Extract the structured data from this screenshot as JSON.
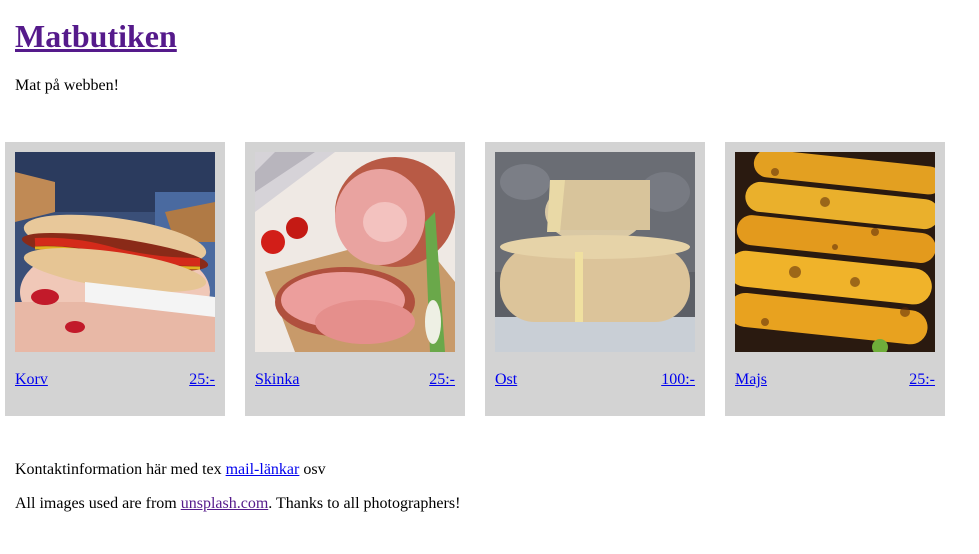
{
  "header": {
    "title": "Matbutiken",
    "tagline": "Mat på webben!"
  },
  "products": [
    {
      "name": "Korv",
      "price": "25:-",
      "image": "hotdog-photo"
    },
    {
      "name": "Skinka",
      "price": "25:-",
      "image": "ham-photo"
    },
    {
      "name": "Ost",
      "price": "100:-",
      "image": "cheese-photo"
    },
    {
      "name": "Majs",
      "price": "25:-",
      "image": "corn-photo"
    }
  ],
  "footer": {
    "contact_before": "Kontaktinformation här med tex ",
    "contact_link": "mail-länkar",
    "contact_after": " osv",
    "credits_before": "All images used are from ",
    "credits_link": "unsplash.com",
    "credits_after": ". Thanks to all photographers!"
  },
  "colors": {
    "card_bg": "#d3d3d3",
    "link": "#0000ee",
    "visited_link": "#551a8b"
  }
}
